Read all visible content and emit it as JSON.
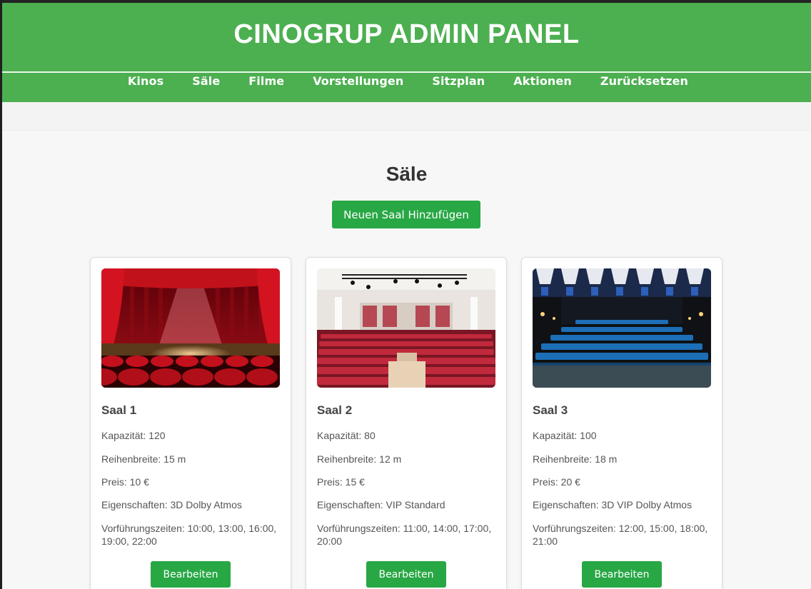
{
  "header": {
    "title": "CINOGRUP ADMIN PANEL"
  },
  "nav": {
    "items": [
      "Kinos",
      "Säle",
      "Filme",
      "Vorstellungen",
      "Sitzplan",
      "Aktionen",
      "Zurücksetzen"
    ]
  },
  "page": {
    "heading": "Säle",
    "add_button": "Neuen Saal Hinzufügen"
  },
  "halls": [
    {
      "name": "Saal 1",
      "capacity": "Kapazität: 120",
      "row_width": "Reihenbreite: 15 m",
      "price": "Preis: 10 €",
      "features": "Eigenschaften: 3D Dolby Atmos",
      "showtimes": "Vorführungszeiten: 10:00, 13:00, 16:00, 19:00, 22:00",
      "edit_label": "Bearbeiten",
      "image": "red-curtain-stage-image"
    },
    {
      "name": "Saal 2",
      "capacity": "Kapazität: 80",
      "row_width": "Reihenbreite: 12 m",
      "price": "Preis: 15 €",
      "features": "Eigenschaften: VIP Standard",
      "showtimes": "Vorführungszeiten: 11:00, 14:00, 17:00, 20:00",
      "edit_label": "Bearbeiten",
      "image": "red-seat-auditorium-image"
    },
    {
      "name": "Saal 3",
      "capacity": "Kapazität: 100",
      "row_width": "Reihenbreite: 18 m",
      "price": "Preis: 20 €",
      "features": "Eigenschaften: 3D VIP Dolby Atmos",
      "showtimes": "Vorführungszeiten: 12:00, 15:00, 18:00, 21:00",
      "edit_label": "Bearbeiten",
      "image": "blue-seat-auditorium-image"
    }
  ],
  "colors": {
    "brand_green": "#4caf50",
    "button_green": "#28a745"
  }
}
